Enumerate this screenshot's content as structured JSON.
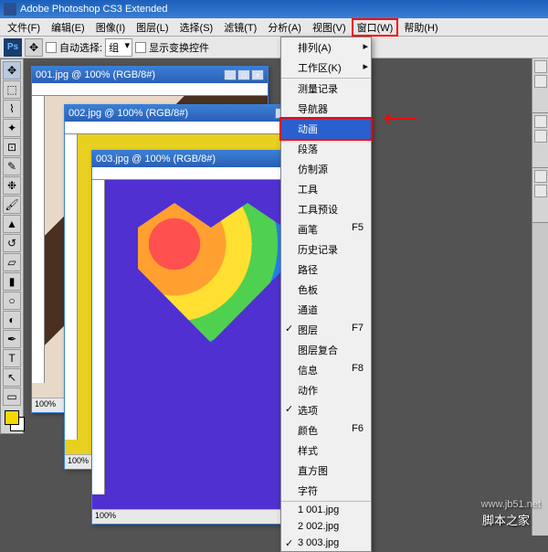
{
  "app": {
    "title": "Adobe Photoshop CS3 Extended"
  },
  "menubar": {
    "file": "文件(F)",
    "edit": "编辑(E)",
    "image": "图像(I)",
    "layer": "图层(L)",
    "select": "选择(S)",
    "filter": "滤镜(T)",
    "analysis": "分析(A)",
    "view": "视图(V)",
    "window": "窗口(W)",
    "help": "帮助(H)"
  },
  "options": {
    "auto_select_label": "自动选择:",
    "auto_select_value": "组",
    "show_transform": "显示变换控件"
  },
  "docs": {
    "d1": {
      "title": "001.jpg @ 100% (RGB/8#)",
      "status": "100%"
    },
    "d2": {
      "title": "002.jpg @ 100% (RGB/8#)",
      "status": "100%"
    },
    "d3": {
      "title": "003.jpg @ 100% (RGB/8#)",
      "status": "100%"
    }
  },
  "windowMenu": {
    "arrange": "排列(A)",
    "workspace": "工作区(K)",
    "measurement_log": "测量记录",
    "navigator": "导航器",
    "animation": "动画",
    "paragraph": "段落",
    "clone_source": "仿制源",
    "tools": "工具",
    "tool_presets": "工具预设",
    "brushes": "画笔",
    "history": "历史记录",
    "paths": "路径",
    "color": "色板",
    "channels": "通道",
    "layers": "图层",
    "layer_comps": "图层复合",
    "info": "信息",
    "actions": "动作",
    "options": "选项",
    "swatches": "颜色",
    "styles": "样式",
    "histogram": "直方图",
    "character": "字符",
    "win1": "1 001.jpg",
    "win2": "2 002.jpg",
    "win3": "3 003.jpg",
    "sc_brushes": "F5",
    "sc_layers": "F7",
    "sc_info": "F8",
    "sc_swatches": "F6"
  },
  "watermark": {
    "main": "脚本之家",
    "sub": "www.jb51.net"
  }
}
